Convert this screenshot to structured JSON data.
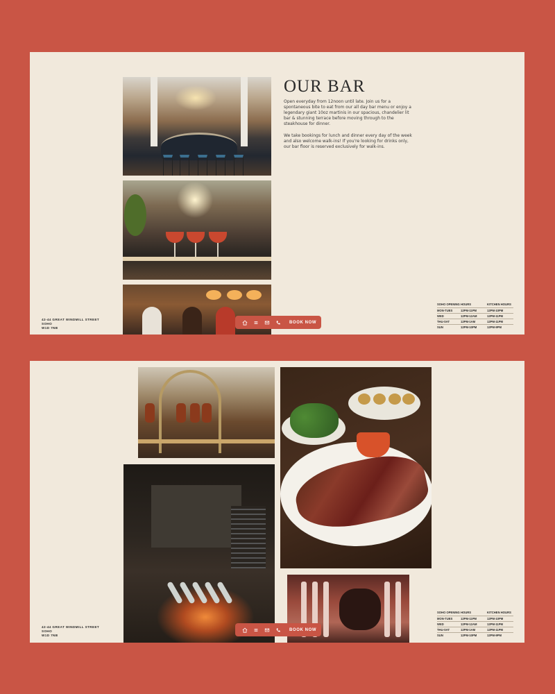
{
  "bar": {
    "title": "OUR BAR",
    "paragraph1": "Open everyday from 12noon until late. Join us for a spontaneous bite to eat from our all day bar menu or enjoy a legendary giant 10oz martinis in our spacious, chandelier lit bar & stunning terrace before moving through to the steakhouse for dinner.",
    "paragraph2": "We take bookings for lunch and dinner every day of the week and also welcome walk-ins! If you're looking for drinks only, our bar floor is reserved exclusively for walk-ins."
  },
  "address": {
    "line1": "42-44 Great Windmill Street",
    "line2": "Soho",
    "line3": "W1D 7NB"
  },
  "hours": {
    "opening_header": "SOHO OPENING HOURS",
    "kitchen_header": "KITCHEN HOURS",
    "rows": [
      {
        "day": "MON-TUES",
        "open": "12PM-11PM",
        "kitchen": "12PM-10PM"
      },
      {
        "day": "WED",
        "open": "12PM-12AM",
        "kitchen": "12PM-11PM"
      },
      {
        "day": "THU-SAT",
        "open": "12PM-1AM",
        "kitchen": "12PM-11PM"
      },
      {
        "day": "SUN",
        "open": "12PM-10PM",
        "kitchen": "12PM-9PM"
      }
    ]
  },
  "booking_bar": {
    "icons": [
      "home-icon",
      "menu-icon",
      "mail-icon",
      "phone-icon"
    ],
    "book_label": "BOOK NOW",
    "color": "#c95545"
  },
  "colors": {
    "page_background": "#c95545",
    "panel_background": "#f1e9dc",
    "text": "#2a2a2a"
  }
}
